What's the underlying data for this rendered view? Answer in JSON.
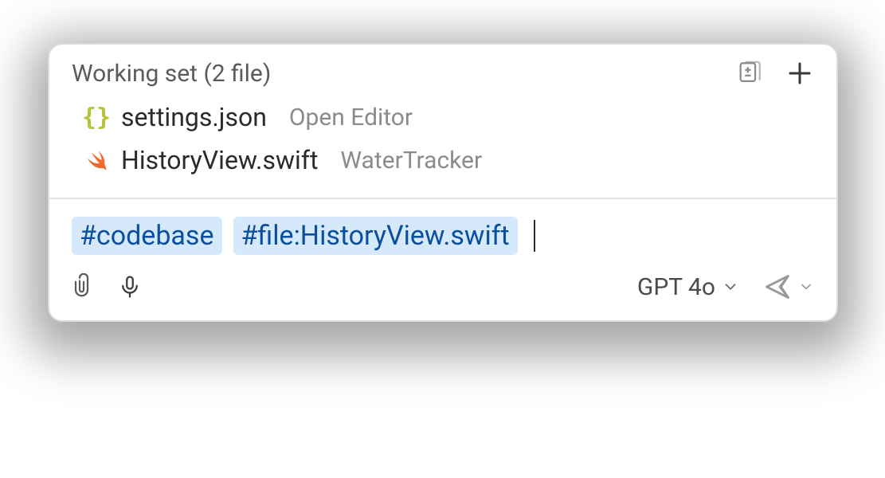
{
  "workingSet": {
    "title": "Working set (2 file)",
    "files": [
      {
        "name": "settings.json",
        "context": "Open Editor",
        "icon": "json-icon"
      },
      {
        "name": "HistoryView.swift",
        "context": "WaterTracker",
        "icon": "swift-icon"
      }
    ]
  },
  "input": {
    "chips": [
      "#codebase",
      "#file:HistoryView.swift"
    ]
  },
  "toolbar": {
    "model": "GPT 4o"
  }
}
